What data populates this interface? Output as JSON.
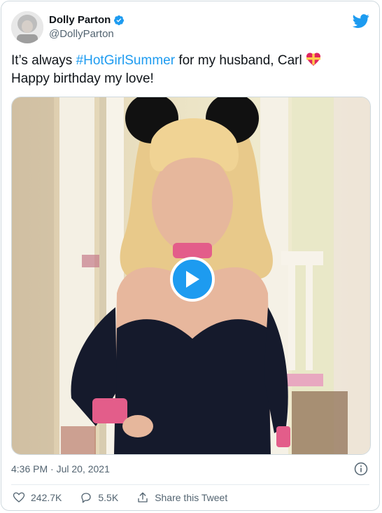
{
  "author": {
    "display_name": "Dolly Parton",
    "handle": "@DollyParton",
    "verified": true
  },
  "tweet": {
    "text_before": "It’s always ",
    "hashtag": "#HotGirlSummer",
    "text_after": " for my husband, Carl ",
    "line2": "Happy birthday my love!",
    "emoji": "heart-with-ribbon"
  },
  "media": {
    "type": "video",
    "play_icon": "play-icon"
  },
  "timestamp": "4:36 PM · Jul 20, 2021",
  "actions": {
    "likes": "242.7K",
    "replies": "5.5K",
    "share_label": "Share this Tweet"
  },
  "colors": {
    "accent": "#1d9bf0",
    "text": "#0f1419",
    "secondary": "#536471"
  }
}
